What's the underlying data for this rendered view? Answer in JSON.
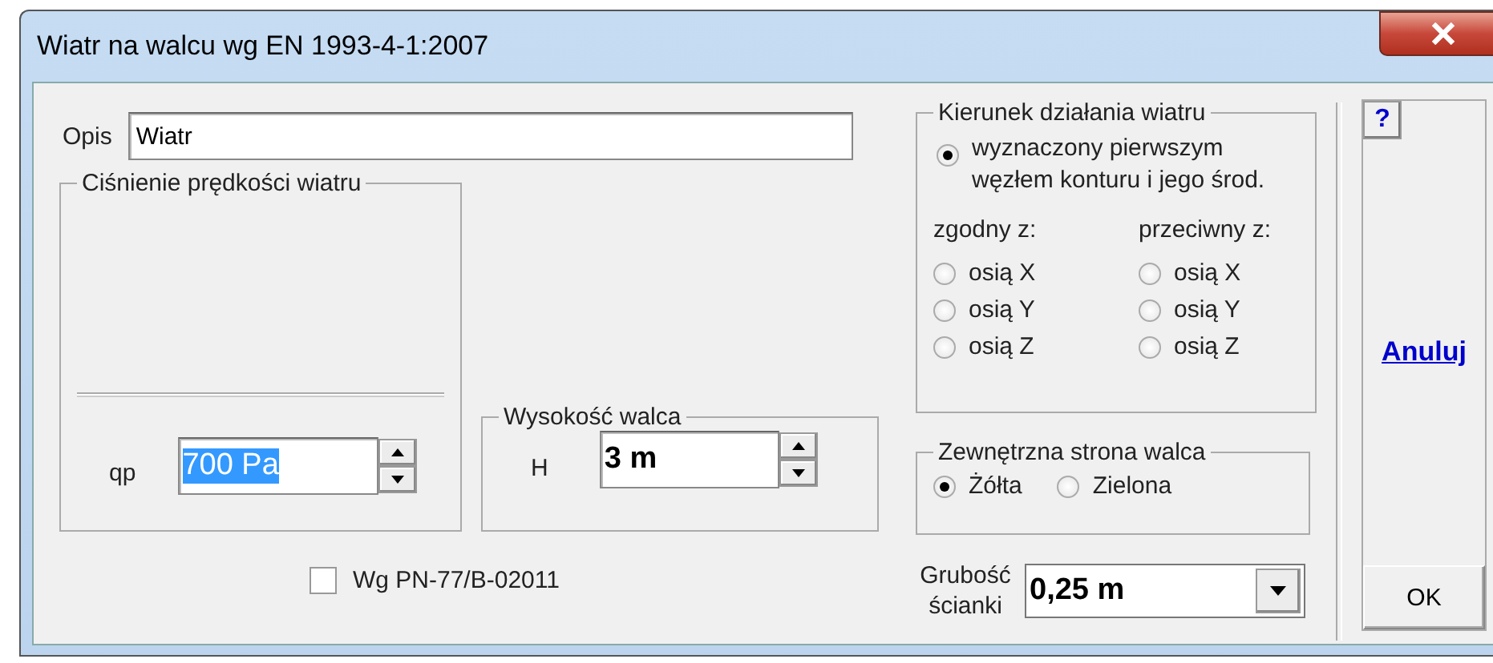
{
  "window": {
    "title": "Wiatr na walcu wg EN 1993-4-1:2007"
  },
  "description": {
    "label": "Opis",
    "value": "Wiatr"
  },
  "pressure": {
    "title": "Ciśnienie prędkości wiatru",
    "label": "qp",
    "value": "700 Pa",
    "value_selected": true
  },
  "height": {
    "title": "Wysokość walca",
    "label": "H",
    "value": "3 m"
  },
  "standard_checkbox": {
    "label": "Wg PN-77/B-02011",
    "checked": false
  },
  "direction": {
    "title": "Kierunek działania wiatru",
    "main_option": {
      "label": "wyznaczony pierwszym węzłem konturu i jego środ.",
      "selected": true
    },
    "columns": [
      {
        "heading": "zgodny z:",
        "options": [
          {
            "label": "osią X",
            "selected": false
          },
          {
            "label": "osią Y",
            "selected": false
          },
          {
            "label": "osią Z",
            "selected": false
          }
        ]
      },
      {
        "heading": "przeciwny z:",
        "options": [
          {
            "label": "osią X",
            "selected": false
          },
          {
            "label": "osią Y",
            "selected": false
          },
          {
            "label": "osią Z",
            "selected": false
          }
        ]
      }
    ]
  },
  "surface": {
    "title": "Zewnętrzna strona walca",
    "options": [
      {
        "label": "Żółta",
        "selected": true
      },
      {
        "label": "Zielona",
        "selected": false
      }
    ]
  },
  "thickness": {
    "label": "Grubość ścianki",
    "value": "0,25 m"
  },
  "help_button": "?",
  "cancel_link": "Anuluj",
  "ok_button": "OK"
}
